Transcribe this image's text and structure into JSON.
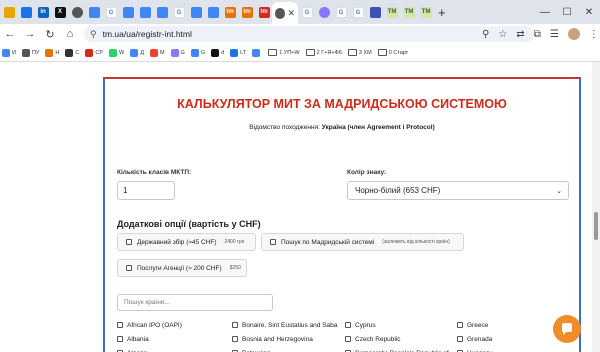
{
  "browser": {
    "url": "tm.ua/ua/registr-int.html",
    "tabs": [
      "tab-1",
      "tab-2",
      "tab-3",
      "tab-4",
      "tab-5",
      "tab-6",
      "tab-7",
      "tab-8",
      "tab-9",
      "tab-10",
      "tab-11",
      "tab-12",
      "tab-13",
      "tab-14",
      "tab-15",
      "tab-active",
      "tab-17",
      "tab-18",
      "tab-19",
      "tab-20",
      "tab-21",
      "tab-22",
      "tab-23",
      "tab-24"
    ],
    "new_tab": "+"
  },
  "bookmarks": [
    {
      "label": "И",
      "icon": "chrome-icon"
    },
    {
      "label": "ПУ",
      "icon": "globe-icon"
    },
    {
      "label": "Н",
      "icon": "tm-icon"
    },
    {
      "label": "С",
      "icon": "shop-icon"
    },
    {
      "label": "СР",
      "icon": "cp-icon"
    },
    {
      "label": "W",
      "icon": "whatsapp-icon"
    },
    {
      "label": "Д",
      "icon": "docs-icon"
    },
    {
      "label": "М",
      "icon": "gmail-icon"
    },
    {
      "label": "G",
      "icon": "gemini-icon"
    },
    {
      "label": "G",
      "icon": "google-icon"
    },
    {
      "label": "d",
      "icon": "d-icon"
    },
    {
      "label": "LT",
      "icon": "lt-icon"
    },
    {
      "label": "",
      "icon": "doc-icon"
    },
    {
      "label": "1 УП+W",
      "icon": "folder-icon"
    },
    {
      "label": "2 Г+Я+Ф6",
      "icon": "folder-icon"
    },
    {
      "label": "3 ХМ",
      "icon": "folder-icon"
    },
    {
      "label": "0 Старт",
      "icon": "folder-icon"
    }
  ],
  "page": {
    "title": "КАЛЬКУЛЯТОР МИТ ЗА МАДРИДСЬКОЮ СИСТЕМОЮ",
    "origin_label": "Відомство походження:",
    "origin_value": "Україна (член Agreement і Protocol)",
    "classes_label": "Кількість класів МКТП:",
    "classes_value": "1",
    "color_label": "Колір знаку:",
    "color_value": "Чорно-білий (653 CHF)",
    "options_heading": "Додаткові опції (вартість у CHF)",
    "options": [
      {
        "label": "Державний збір (≈45 CHF)",
        "note": "2400 грн"
      },
      {
        "label": "Пошук по Мадридській системі",
        "note": "(залежить від кількості країн)"
      },
      {
        "label": "Послуги Агенції (≈ 200 CHF)",
        "note": "$250"
      }
    ],
    "search_placeholder": "Пошук країни...",
    "countries": [
      "African IPO (OAPI)",
      "Bonaire, Sint Eustatius and Saba",
      "Cyprus",
      "Greece",
      "Albania",
      "Bosnia and Herzegovina",
      "Czech Republic",
      "Grenada",
      "Algeria",
      "Botswana",
      "Democratic People's Republic of Korea",
      "Hungary"
    ]
  },
  "colors": {
    "title_red": "#d12a1b",
    "card_border_blue": "#3a6bd6",
    "chat_orange": "#f28c28"
  }
}
